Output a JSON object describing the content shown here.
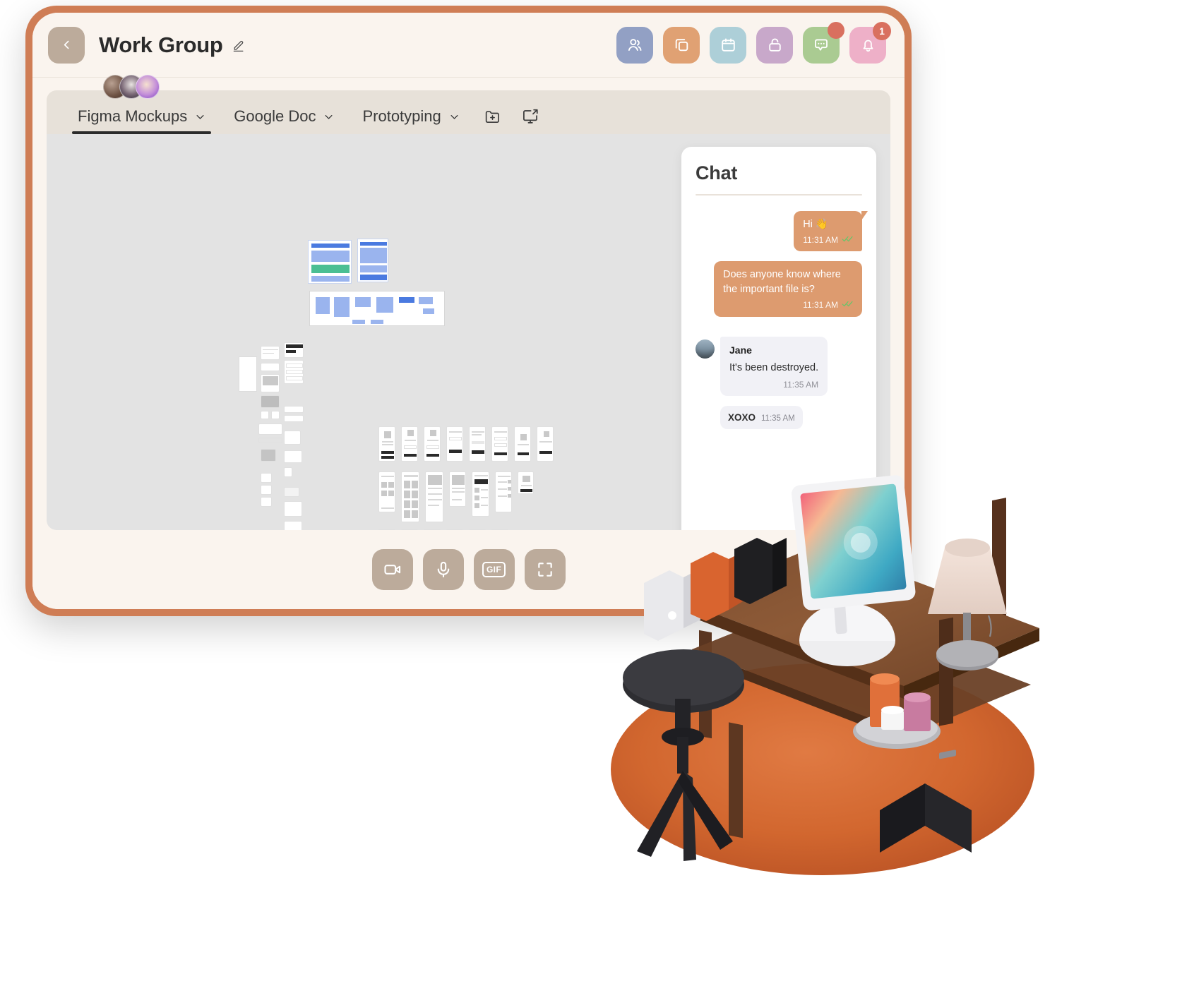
{
  "window": {
    "title": "Work Group",
    "back_icon": "chevron-left-icon",
    "edit_icon": "pencil-edit-icon"
  },
  "toolbar_actions": [
    {
      "name": "members",
      "icon": "people-icon",
      "color": "#92a0c4",
      "badge": null
    },
    {
      "name": "files",
      "icon": "copy-icon",
      "color": "#e0a173",
      "badge": null
    },
    {
      "name": "calendar",
      "icon": "calendar-icon",
      "color": "#adcfd8",
      "badge": null
    },
    {
      "name": "lock",
      "icon": "unlock-icon",
      "color": "#c8a8ca",
      "badge": null
    },
    {
      "name": "chat",
      "icon": "chat-bubble-icon",
      "color": "#aacb92",
      "badge": ""
    },
    {
      "name": "notifications",
      "icon": "bell-icon",
      "color": "#eeb0c8",
      "badge": "1"
    }
  ],
  "badge_color": "#d9705f",
  "accent_color": "#cf7d55",
  "tabs": [
    {
      "label": "Figma Mockups",
      "active": true,
      "caret": "chevron-down-icon"
    },
    {
      "label": "Google Doc",
      "active": false,
      "caret": "chevron-down-icon"
    },
    {
      "label": "Prototyping",
      "active": false,
      "caret": "chevron-down-icon"
    }
  ],
  "tab_actions": [
    {
      "name": "new-folder",
      "icon": "folder-plus-icon"
    },
    {
      "name": "present",
      "icon": "screen-share-icon"
    }
  ],
  "avatars": [
    {
      "name": "avatar-1"
    },
    {
      "name": "avatar-2"
    },
    {
      "name": "avatar-3"
    }
  ],
  "chat": {
    "title": "Chat",
    "messages": [
      {
        "direction": "out",
        "text": "Hi 👋",
        "time": "11:31 AM",
        "status": "read",
        "sender": null,
        "tail": true
      },
      {
        "direction": "out",
        "text": "Does anyone know where the important file is?",
        "time": "11:31 AM",
        "status": "read",
        "sender": null,
        "tail": false
      },
      {
        "direction": "in",
        "sender": "Jane",
        "text": "It's been destroyed.",
        "time": "11:35 AM",
        "status": null,
        "avatar": true
      },
      {
        "direction": "in",
        "sender": null,
        "text": "XOXO",
        "time": "11:35 AM",
        "status": null,
        "avatar": false
      }
    ]
  },
  "bottom_controls": [
    {
      "name": "video-toggle",
      "icon": "video-camera-icon"
    },
    {
      "name": "microphone-toggle",
      "icon": "microphone-icon"
    },
    {
      "name": "gif-picker",
      "icon": "gif-icon",
      "label": "GIF"
    },
    {
      "name": "fullscreen-toggle",
      "icon": "fullscreen-icon"
    }
  ],
  "scene": {
    "name": "isometric-desk-illustration",
    "items": [
      "tablet-on-stand",
      "desk-lamp",
      "candles",
      "stool",
      "rug",
      "binders",
      "drawer-unit"
    ]
  }
}
